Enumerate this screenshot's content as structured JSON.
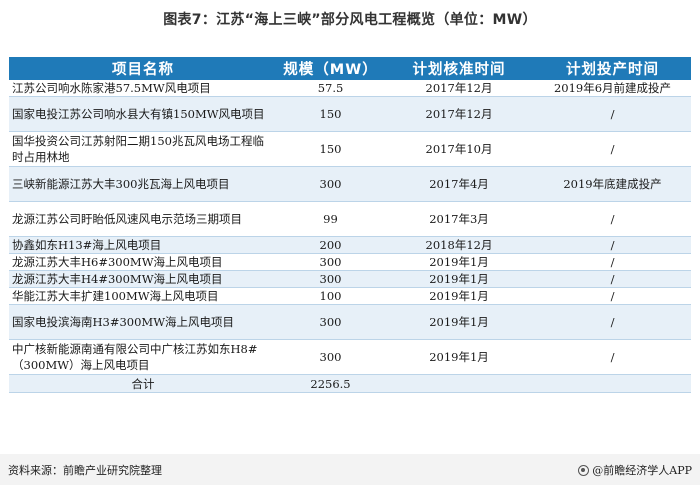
{
  "title": "图表7：江苏“海上三峡”部分风电工程概览（单位：MW）",
  "table": {
    "headers": [
      "项目名称",
      "规模（MW）",
      "计划核准时间",
      "计划投产时间"
    ],
    "rows": [
      {
        "name": "江苏公司响水陈家港57.5MW风电项目",
        "scale": "57.5",
        "approval": "2017年12月",
        "production": "2019年6月前建成投产",
        "tall": false
      },
      {
        "name": "国家电投江苏公司响水县大有镇150MW风电项目",
        "scale": "150",
        "approval": "2017年12月",
        "production": "/",
        "tall": true
      },
      {
        "name": "国华投资公司江苏射阳二期150兆瓦风电场工程临时占用林地",
        "scale": "150",
        "approval": "2017年10月",
        "production": "/",
        "tall": true
      },
      {
        "name": "三峡新能源江苏大丰300兆瓦海上风电项目",
        "scale": "300",
        "approval": "2017年4月",
        "production": "2019年底建成投产",
        "tall": true
      },
      {
        "name": "龙源江苏公司盱眙低风速风电示范场三期项目",
        "scale": "99",
        "approval": "2017年3月",
        "production": "/",
        "tall": true
      },
      {
        "name": "协鑫如东H13#海上风电项目",
        "scale": "200",
        "approval": "2018年12月",
        "production": "/",
        "tall": false
      },
      {
        "name": "龙源江苏大丰H6#300MW海上风电项目",
        "scale": "300",
        "approval": "2019年1月",
        "production": "/",
        "tall": false
      },
      {
        "name": "龙源江苏大丰H4#300MW海上风电项目",
        "scale": "300",
        "approval": "2019年1月",
        "production": "/",
        "tall": false
      },
      {
        "name": "华能江苏大丰扩建100MW海上风电项目",
        "scale": "100",
        "approval": "2019年1月",
        "production": "/",
        "tall": false
      },
      {
        "name": "国家电投滨海南H3#300MW海上风电项目",
        "scale": "300",
        "approval": "2019年1月",
        "production": "/",
        "tall": true
      },
      {
        "name": "中广核新能源南通有限公司中广核江苏如东H8#（300MW）海上风电项目",
        "scale": "300",
        "approval": "2019年1月",
        "production": "/",
        "tall": true
      }
    ],
    "total": {
      "label": "合计",
      "value": "2256.5"
    }
  },
  "footer": {
    "source": "资料来源：前瞻产业研究院整理",
    "brand": "@前瞻经济学人APP",
    "brand_icon": "brand-logo-icon"
  },
  "colors": {
    "header_bg": "#1f7ab8",
    "alt_row_bg": "#e7f0f8",
    "footer_bg": "#f3f3f3"
  }
}
